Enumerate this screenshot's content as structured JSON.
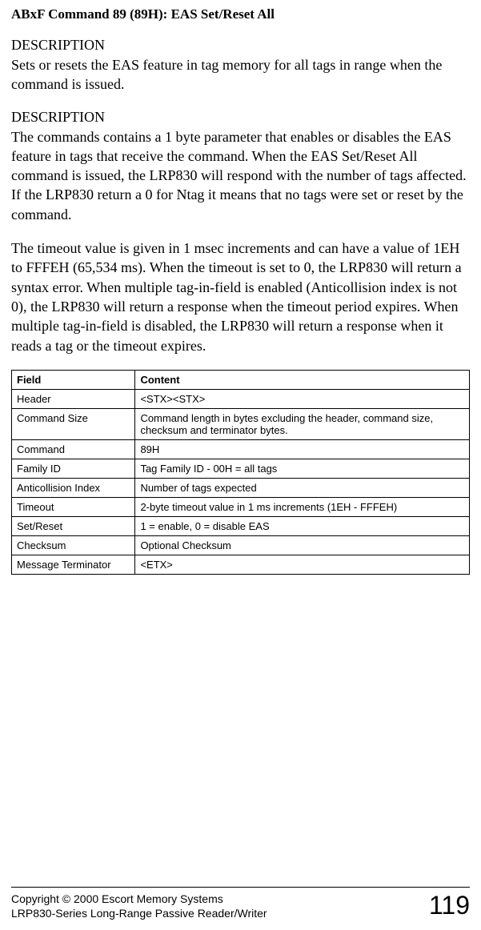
{
  "title": "ABxF Command 89 (89H): EAS Set/Reset All",
  "sections": {
    "desc1_heading": "DESCRIPTION",
    "desc1_body": "Sets or resets the EAS feature in tag memory for all tags in range when the command is issued.",
    "desc2_heading": "DESCRIPTION",
    "desc2_body": "The commands contains a 1 byte parameter that enables or disables the EAS feature in tags that receive the command. When the EAS Set/Reset All command is issued, the LRP830 will respond with the number of tags affected. If the LRP830 return a 0 for Ntag it means that no tags were set or reset by the command.",
    "desc3_body": "The timeout value is given in 1 msec increments  and can have a value of 1EH to FFFEH (65,534 ms).  When the timeout is set to 0, the LRP830 will return a syntax error. When multiple tag-in-field is enabled (Anticollision index is not 0), the LRP830 will return a response when the timeout period expires. When multiple tag-in-field is disabled, the LRP830 will return a response when it reads a tag or the timeout expires."
  },
  "table": {
    "headers": {
      "field": "Field",
      "content": "Content"
    },
    "rows": [
      {
        "field": "Header",
        "content": "<STX><STX>"
      },
      {
        "field": "Command Size",
        "content": "Command length in bytes excluding the header, command size, checksum and terminator bytes."
      },
      {
        "field": "Command",
        "content": "89H"
      },
      {
        "field": "Family ID",
        "content": "Tag Family ID - 00H = all tags"
      },
      {
        "field": "Anticollision Index",
        "content": "Number of tags expected"
      },
      {
        "field": "Timeout",
        "content": "2-byte timeout value in 1 ms increments (1EH - FFFEH)"
      },
      {
        "field": "Set/Reset",
        "content": "1 = enable, 0 = disable EAS"
      },
      {
        "field": "Checksum",
        "content": "Optional Checksum"
      },
      {
        "field": "Message Terminator",
        "content": "<ETX>"
      }
    ]
  },
  "footer": {
    "line1": "Copyright © 2000 Escort Memory Systems",
    "line2": "LRP830-Series Long-Range Passive Reader/Writer",
    "pagenum": "119"
  }
}
